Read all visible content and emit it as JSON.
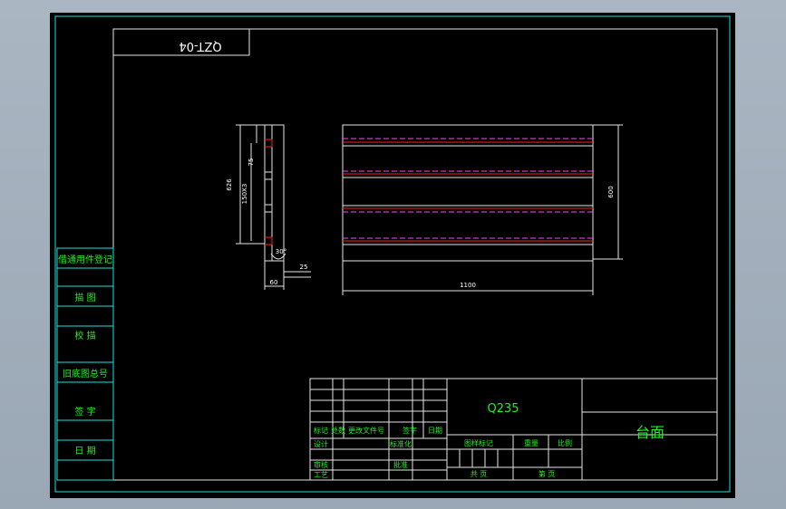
{
  "drawing": {
    "number_upside_down": "QZT-04",
    "part_name": "台面",
    "material": "Q235"
  },
  "left_panel": {
    "labels": [
      "借通用件登记",
      "描 图",
      "校 描",
      "旧底图总号",
      "签 字",
      "日 期"
    ]
  },
  "title_block": {
    "row_labels": [
      "标记",
      "处数",
      "更改文件号",
      "签字",
      "日期"
    ],
    "role_labels": [
      "设计",
      "审核",
      "工艺"
    ],
    "mid_labels": [
      "标准化",
      "批准"
    ],
    "stage_label": "图样标记",
    "weight_label": "重量",
    "scale_label": "比例",
    "sheet_total_label": "共 页",
    "sheet_label": "第 页"
  },
  "side_view": {
    "dim_overall": "626",
    "dim_spacing": "150X3",
    "dim_top": "75",
    "dim_width": "60",
    "dim_right": "25",
    "angle": "30°"
  },
  "front_view": {
    "dim_length": "1100",
    "dim_height": "600"
  },
  "colors": {
    "background": "#000000",
    "frame": "#20e0e0",
    "text": "#19f519",
    "geometry": "#e6e6e6",
    "accent_red": "#ff2020",
    "accent_magenta": "#ff40ff"
  }
}
